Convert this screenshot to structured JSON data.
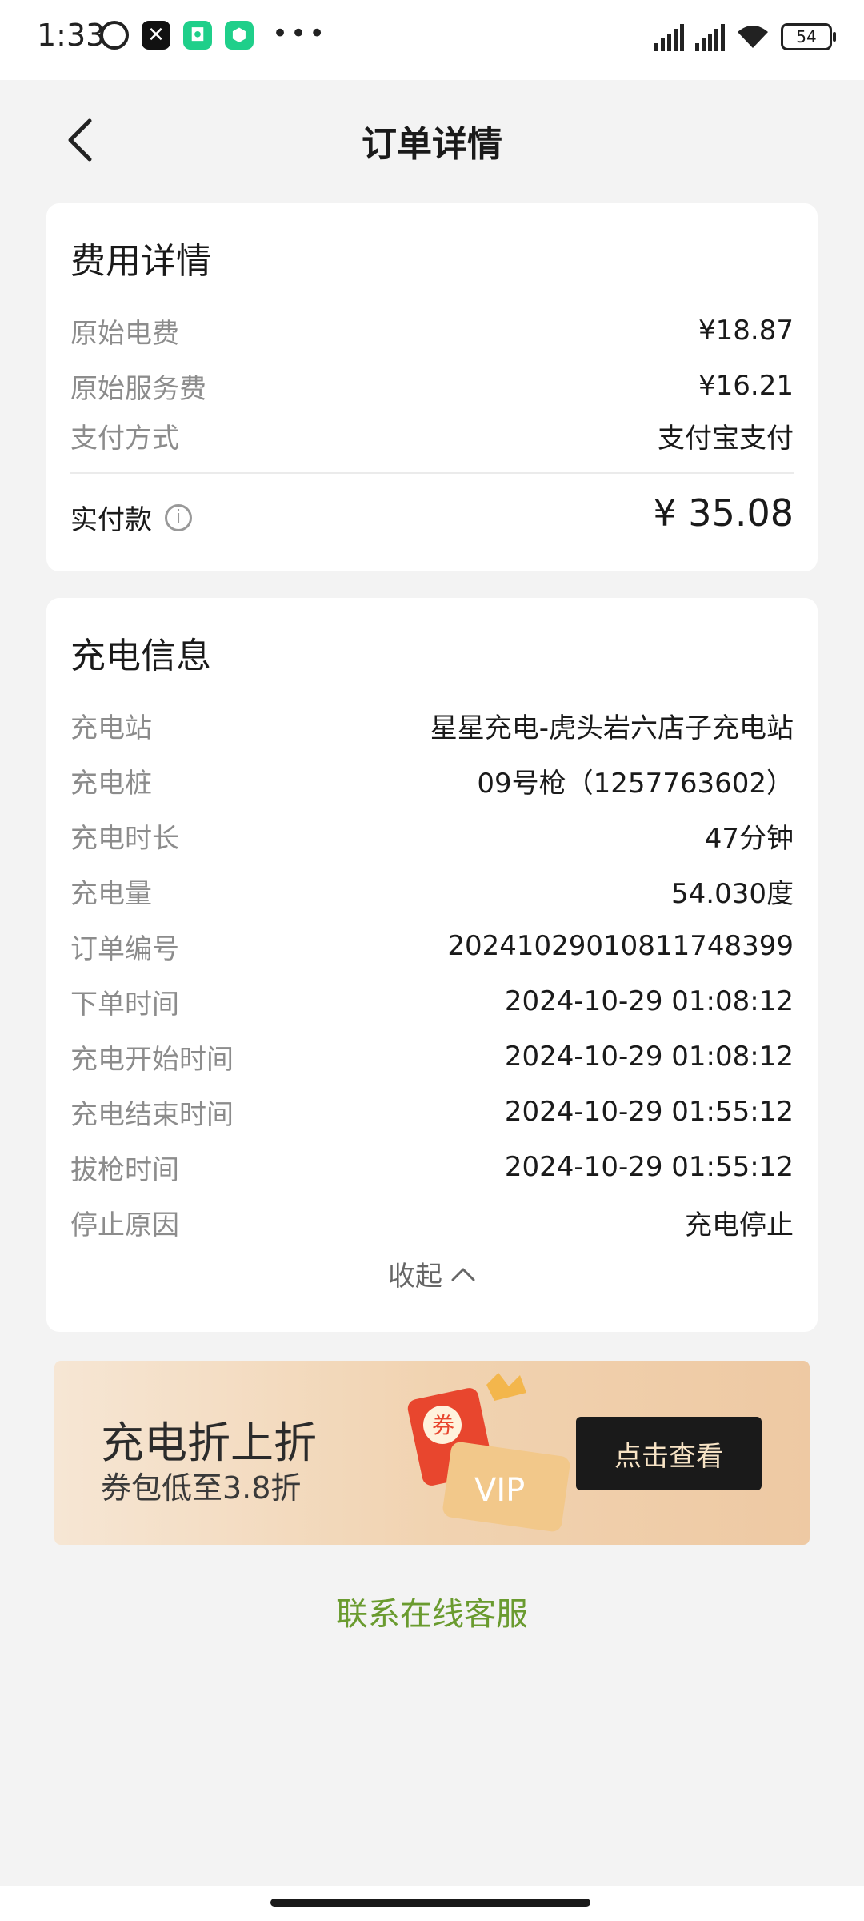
{
  "status_bar": {
    "time": "1:33",
    "battery": "54",
    "icons": [
      "alarm-icon",
      "x-app-icon",
      "green-app-icon",
      "green-shield-icon",
      "more-dots-icon",
      "signal-hd-icon",
      "signal-hd-icon",
      "wifi-icon",
      "battery-icon"
    ]
  },
  "header": {
    "title": "订单详情",
    "back_icon": "chevron-left-icon"
  },
  "fee_card": {
    "title": "费用详情",
    "rows": [
      {
        "label": "原始电费",
        "value": "¥18.87"
      },
      {
        "label": "原始服务费",
        "value": "¥16.21"
      },
      {
        "label": "支付方式",
        "value": "支付宝支付"
      }
    ],
    "paid_label": "实付款",
    "paid_value": "¥ 35.08",
    "info_icon": "i"
  },
  "charge_card": {
    "title": "充电信息",
    "rows": [
      {
        "label": "充电站",
        "value": "星星充电-虎头岩六店子充电站"
      },
      {
        "label": "充电桩",
        "value": "09号枪（1257763602）"
      },
      {
        "label": "充电时长",
        "value": "47分钟"
      },
      {
        "label": "充电量",
        "value": "54.030度"
      },
      {
        "label": "订单编号",
        "value": "202410290108117483​99"
      },
      {
        "label": "下单时间",
        "value": "2024-10-29 01:08:12"
      },
      {
        "label": "充电开始时间",
        "value": "2024-10-29 01:08:12"
      },
      {
        "label": "充电结束时间",
        "value": "2024-10-29 01:55:12"
      },
      {
        "label": "拔枪时间",
        "value": "2024-10-29 01:55:12"
      },
      {
        "label": "停止原因",
        "value": "充电停止"
      }
    ],
    "collapse_label": "收起"
  },
  "banner": {
    "title": "充电折上折",
    "subtitle": "券包低至3.8折",
    "cta": "点击查看",
    "coupon_text": "券",
    "vip_text": "VIP"
  },
  "service_link": "联系在线客服",
  "colors": {
    "background": "#f3f3f3",
    "card": "#ffffff",
    "label_gray": "#8c8c8c",
    "service_green": "#6a9b2f",
    "banner_cta_bg": "#1a1a1a"
  }
}
